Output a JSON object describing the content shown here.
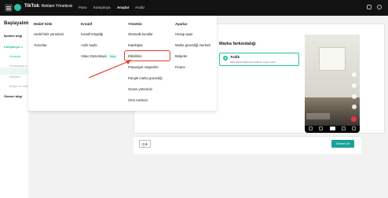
{
  "topbar": {
    "brand": "TikTok",
    "brand_sub": ": Reklam Yöneticisi",
    "nav": [
      "Pano",
      "Kampanya",
      "Araçlar",
      "Analiz"
    ],
    "active_nav": "Araçlar",
    "icons": [
      "menu-icon",
      "bell-icon",
      "help-icon"
    ]
  },
  "sidebar": {
    "title": "Başlayalım",
    "items": [
      "İşletme bilgi",
      "Kampanya o",
      "Amaçlar",
      "Kampanya a",
      "Reklam",
      "Bütçe ve teklif",
      "Ödeme bilgi"
    ]
  },
  "dropdown": {
    "columns": [
      {
        "header": "Hedef Kitle",
        "items": [
          "Hedef kitle yöneticisi",
          "Yorumlar"
        ]
      },
      {
        "header": "Kreatif",
        "items": [
          "Kreatif Kitaplığı",
          "Anlık sayfa",
          "Video Düzenleyici"
        ],
        "badge": "New"
      },
      {
        "header": "Yönetim",
        "items": [
          "Otomatik kurallar",
          "Kataloglar",
          "Etkinlikler",
          "Potansiyel müşteriler",
          "Pangle marka güvenliği",
          "Güven yöneticisi",
          "Ürün merkezi"
        ]
      },
      {
        "header": "Ayarlar",
        "items": [
          "Hesap ayarı",
          "Marka güvenliği merkezi",
          "Belgeler",
          "Finans"
        ]
      }
    ],
    "highlighted": "Etkinlikler"
  },
  "main": {
    "brand_awareness": "Marka farkındalığı",
    "option_title": "Trafik",
    "option_desc": "Web sitenizi daha çok kullanıcı ziyaret etsin",
    "exit_label": "Çık",
    "continue_label": "Devam et"
  },
  "colors": {
    "accent": "#25c3a0",
    "highlight": "#e23a2e",
    "topbar": "#121212"
  }
}
